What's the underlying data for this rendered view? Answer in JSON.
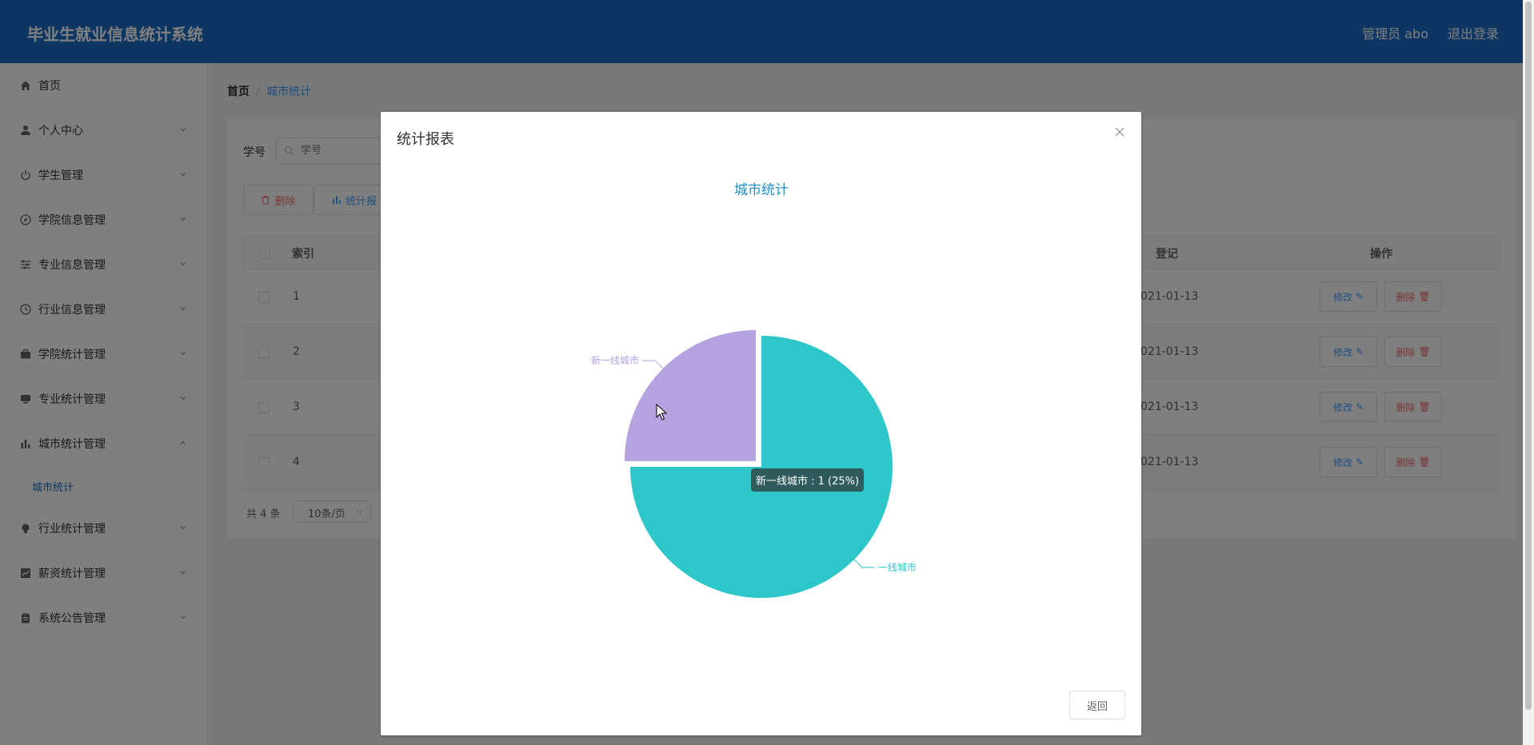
{
  "app": {
    "title": "毕业生就业信息统计系统",
    "user": "管理员 abo",
    "logout": "退出登录"
  },
  "sidebar": {
    "items": [
      {
        "label": "首页",
        "icon": "home-icon"
      },
      {
        "label": "个人中心",
        "icon": "user-icon"
      },
      {
        "label": "学生管理",
        "icon": "power-icon"
      },
      {
        "label": "学院信息管理",
        "icon": "compass-icon"
      },
      {
        "label": "专业信息管理",
        "icon": "sliders-icon"
      },
      {
        "label": "行业信息管理",
        "icon": "clock-icon"
      },
      {
        "label": "学院统计管理",
        "icon": "briefcase-icon"
      },
      {
        "label": "专业统计管理",
        "icon": "monitor-icon"
      },
      {
        "label": "城市统计管理",
        "icon": "bar-chart-icon"
      },
      {
        "label": "行业统计管理",
        "icon": "bulb-icon"
      },
      {
        "label": "薪资统计管理",
        "icon": "trend-icon"
      },
      {
        "label": "系统公告管理",
        "icon": "clipboard-icon"
      }
    ],
    "active_sub": "城市统计"
  },
  "breadcrumb": {
    "home": "首页",
    "sep": "/",
    "current": "城市统计"
  },
  "search": {
    "label": "学号",
    "placeholder": "学号"
  },
  "toolbar": {
    "delete": "删除",
    "report": "统计报"
  },
  "table": {
    "headers": {
      "index": "索引",
      "date": "登记",
      "ops": "操作"
    },
    "rows": [
      {
        "index": "1",
        "date": "021-01-13"
      },
      {
        "index": "2",
        "date": "021-01-13"
      },
      {
        "index": "3",
        "date": "021-01-13"
      },
      {
        "index": "4",
        "date": "021-01-13"
      }
    ],
    "edit": "修改",
    "del": "删除"
  },
  "pager": {
    "total": "共 4 条",
    "size": "10条/页"
  },
  "dialog": {
    "title": "统计报表",
    "back": "返回"
  },
  "chart_data": {
    "type": "pie",
    "title": "城市统计",
    "slices": [
      {
        "name": "新一线城市",
        "value": 1,
        "color": "#b6a2de"
      },
      {
        "name": "一线城市",
        "value": 3,
        "color": "#2ec7c9"
      }
    ],
    "highlighted": "新一线城市",
    "tooltip": "新一线城市 : 1 (25%)"
  },
  "colors": {
    "header": "#1c6dc4",
    "accent": "#409eff",
    "danger": "#f56c6c"
  }
}
